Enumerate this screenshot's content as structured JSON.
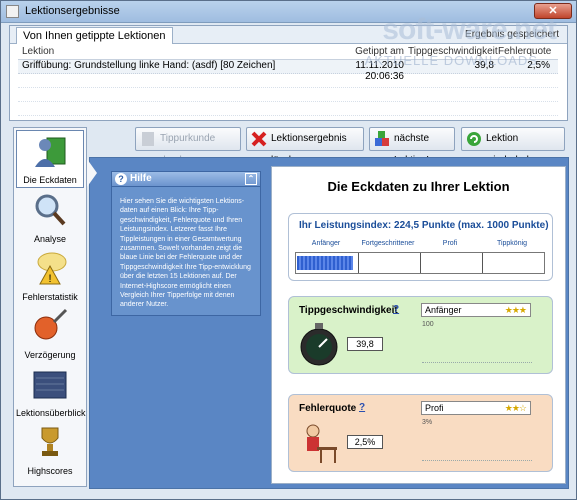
{
  "window": {
    "title": "Lektionsergebnisse",
    "close_label": "✕"
  },
  "watermark": {
    "brand": "soft-ware.net",
    "tagline": "AKTUELLE DOWNLOADS"
  },
  "top_panel": {
    "tab_label": "Von Ihnen getippte Lektionen",
    "right_text": "Ergebnis gespeichert",
    "columns": [
      "Lektion",
      "Getippt am",
      "Tippgeschwindigkeit",
      "Fehlerquote"
    ],
    "rows": [
      [
        "Griffübung: Grundstellung linke Hand: (asdf) [80 Zeichen]",
        "11.11.2010 20:06:36",
        "39,8",
        "2,5%"
      ]
    ]
  },
  "sidebar": {
    "items": [
      {
        "label": "Die Eckdaten",
        "icon": "person-board-icon"
      },
      {
        "label": "Analyse",
        "icon": "magnifier-icon"
      },
      {
        "label": "Fehlerstatistik",
        "icon": "warning-icon"
      },
      {
        "label": "Verzögerung",
        "icon": "brush-ball-icon"
      },
      {
        "label": "Lektionsüberblick",
        "icon": "chart-icon"
      },
      {
        "label": "Highscores",
        "icon": "trophy-icon"
      }
    ]
  },
  "toolbar": {
    "print_label": "Tippurkunde drucken",
    "delete_label": "Lektionsergebnis löschen",
    "next_label": "nächste Lektion!",
    "repeat_label": "Lektion wiederholen"
  },
  "help": {
    "title": "Hilfe",
    "text": "Hier sehen Sie die wichtigsten Lektions-daten auf einen Blick: Ihre Tipp-geschwindigkeit, Fehlerquote und Ihren Leistungsindex. Letzerer fasst Ihre Tippleistungen in einer Gesamtwertung zusammen. Sowelt vorhanden zeigt die blaue Linie bei der Fehlerquote und der Tippgeschwindigkeit Ihre Tipp-entwicklung über die letzten 15 Lektionen auf. Der Internet-Highscore ermöglicht einen Vergleich Ihrer Tipperfolge mit denen anderer Nutzer."
  },
  "main": {
    "title": "Die Eckdaten zu Ihrer Lektion",
    "index_label": "Ihr Leistungsindex: 224,5 Punkte (max. 1000 Punkte)",
    "index_value": 224.5,
    "index_max": 1000,
    "levels": [
      "Anfänger",
      "Fortgeschrittener",
      "Profi",
      "Tippkönig"
    ],
    "speed": {
      "title": "Tippgeschwindigkeit",
      "help": "?",
      "value": "39,8",
      "level": "Anfänger",
      "stars": "★★★",
      "scale": "100"
    },
    "errors": {
      "title": "Fehlerquote",
      "help": "?",
      "value": "2,5%",
      "level": "Profi",
      "stars": "★★☆",
      "scale": "3%"
    }
  }
}
